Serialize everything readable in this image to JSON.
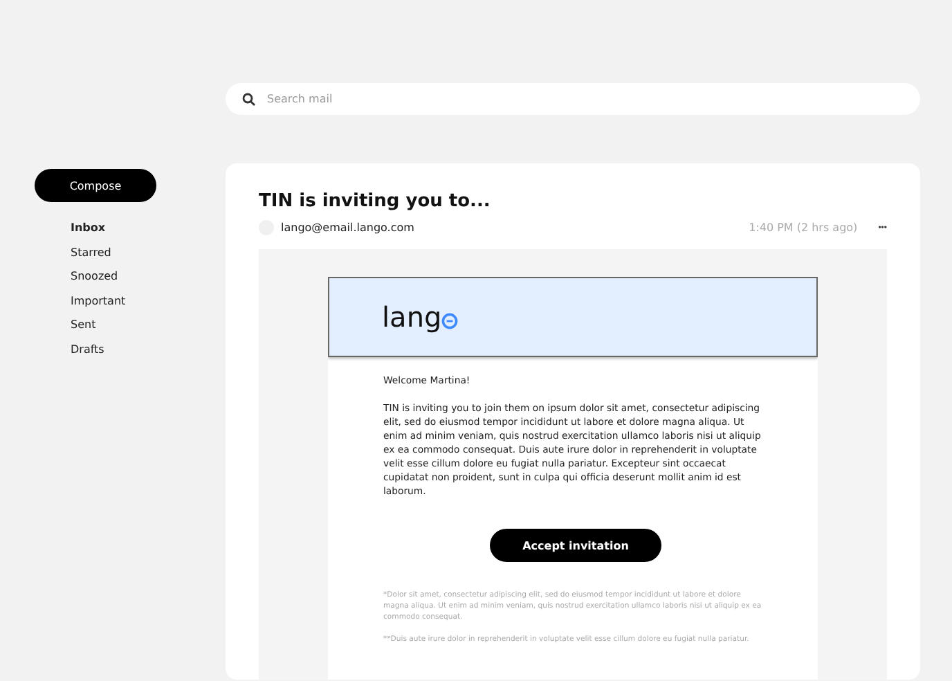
{
  "search": {
    "placeholder": "Search mail"
  },
  "compose": "Compose",
  "nav": [
    {
      "label": "Inbox",
      "selected": true
    },
    {
      "label": "Starred",
      "selected": false
    },
    {
      "label": "Snoozed",
      "selected": false
    },
    {
      "label": "Important",
      "selected": false
    },
    {
      "label": "Sent",
      "selected": false
    },
    {
      "label": "Drafts",
      "selected": false
    }
  ],
  "message": {
    "subject": "TIN is inviting you to...",
    "sender": "lango@email.lango.com",
    "time": "1:40 PM (2 hrs ago)",
    "more": "•••",
    "logo": "lang",
    "greeting": "Welcome Martina!",
    "body": "TIN is inviting you to join them on ipsum dolor sit amet, consectetur adipiscing elit, sed do eiusmod tempor incididunt ut labore et dolore magna aliqua. Ut enim ad minim veniam, quis nostrud exercitation ullamco laboris nisi ut aliquip ex ea commodo consequat. Duis aute irure dolor in reprehenderit in voluptate velit esse cillum dolore eu fugiat nulla pariatur. Excepteur sint occaecat cupidatat non proident, sunt in culpa qui officia deserunt mollit anim id est laborum.",
    "button": "Accept invitation",
    "footnotes": [
      "*Dolor sit amet, consectetur adipiscing elit, sed do eiusmod tempor incididunt ut labore et dolore magna aliqua. Ut enim ad minim veniam, quis nostrud exercitation ullamco laboris nisi ut aliquip ex ea commodo consequat.",
      "**Duis aute irure dolor in reprehenderit in voluptate velit esse cillum dolore eu fugiat nulla pariatur."
    ]
  }
}
